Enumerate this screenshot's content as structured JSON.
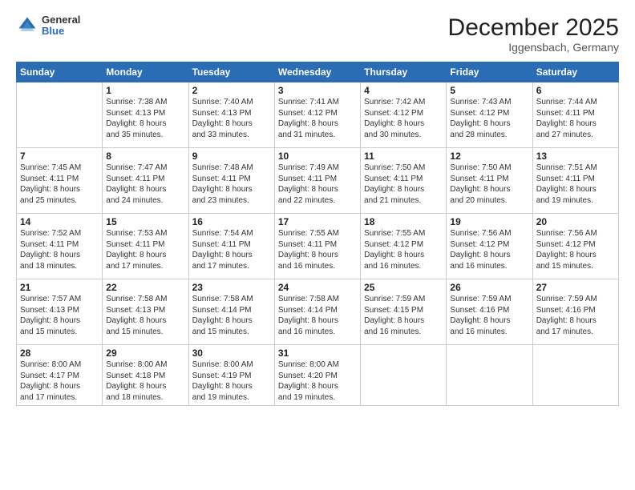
{
  "header": {
    "logo": {
      "general": "General",
      "blue": "Blue"
    },
    "title": "December 2025",
    "subtitle": "Iggensbach, Germany"
  },
  "days_of_week": [
    "Sunday",
    "Monday",
    "Tuesday",
    "Wednesday",
    "Thursday",
    "Friday",
    "Saturday"
  ],
  "weeks": [
    [
      {
        "day": "",
        "sunrise": "",
        "sunset": "",
        "daylight": ""
      },
      {
        "day": "1",
        "sunrise": "Sunrise: 7:38 AM",
        "sunset": "Sunset: 4:13 PM",
        "daylight": "Daylight: 8 hours and 35 minutes."
      },
      {
        "day": "2",
        "sunrise": "Sunrise: 7:40 AM",
        "sunset": "Sunset: 4:13 PM",
        "daylight": "Daylight: 8 hours and 33 minutes."
      },
      {
        "day": "3",
        "sunrise": "Sunrise: 7:41 AM",
        "sunset": "Sunset: 4:12 PM",
        "daylight": "Daylight: 8 hours and 31 minutes."
      },
      {
        "day": "4",
        "sunrise": "Sunrise: 7:42 AM",
        "sunset": "Sunset: 4:12 PM",
        "daylight": "Daylight: 8 hours and 30 minutes."
      },
      {
        "day": "5",
        "sunrise": "Sunrise: 7:43 AM",
        "sunset": "Sunset: 4:12 PM",
        "daylight": "Daylight: 8 hours and 28 minutes."
      },
      {
        "day": "6",
        "sunrise": "Sunrise: 7:44 AM",
        "sunset": "Sunset: 4:11 PM",
        "daylight": "Daylight: 8 hours and 27 minutes."
      }
    ],
    [
      {
        "day": "7",
        "sunrise": "Sunrise: 7:45 AM",
        "sunset": "Sunset: 4:11 PM",
        "daylight": "Daylight: 8 hours and 25 minutes."
      },
      {
        "day": "8",
        "sunrise": "Sunrise: 7:47 AM",
        "sunset": "Sunset: 4:11 PM",
        "daylight": "Daylight: 8 hours and 24 minutes."
      },
      {
        "day": "9",
        "sunrise": "Sunrise: 7:48 AM",
        "sunset": "Sunset: 4:11 PM",
        "daylight": "Daylight: 8 hours and 23 minutes."
      },
      {
        "day": "10",
        "sunrise": "Sunrise: 7:49 AM",
        "sunset": "Sunset: 4:11 PM",
        "daylight": "Daylight: 8 hours and 22 minutes."
      },
      {
        "day": "11",
        "sunrise": "Sunrise: 7:50 AM",
        "sunset": "Sunset: 4:11 PM",
        "daylight": "Daylight: 8 hours and 21 minutes."
      },
      {
        "day": "12",
        "sunrise": "Sunrise: 7:50 AM",
        "sunset": "Sunset: 4:11 PM",
        "daylight": "Daylight: 8 hours and 20 minutes."
      },
      {
        "day": "13",
        "sunrise": "Sunrise: 7:51 AM",
        "sunset": "Sunset: 4:11 PM",
        "daylight": "Daylight: 8 hours and 19 minutes."
      }
    ],
    [
      {
        "day": "14",
        "sunrise": "Sunrise: 7:52 AM",
        "sunset": "Sunset: 4:11 PM",
        "daylight": "Daylight: 8 hours and 18 minutes."
      },
      {
        "day": "15",
        "sunrise": "Sunrise: 7:53 AM",
        "sunset": "Sunset: 4:11 PM",
        "daylight": "Daylight: 8 hours and 17 minutes."
      },
      {
        "day": "16",
        "sunrise": "Sunrise: 7:54 AM",
        "sunset": "Sunset: 4:11 PM",
        "daylight": "Daylight: 8 hours and 17 minutes."
      },
      {
        "day": "17",
        "sunrise": "Sunrise: 7:55 AM",
        "sunset": "Sunset: 4:11 PM",
        "daylight": "Daylight: 8 hours and 16 minutes."
      },
      {
        "day": "18",
        "sunrise": "Sunrise: 7:55 AM",
        "sunset": "Sunset: 4:12 PM",
        "daylight": "Daylight: 8 hours and 16 minutes."
      },
      {
        "day": "19",
        "sunrise": "Sunrise: 7:56 AM",
        "sunset": "Sunset: 4:12 PM",
        "daylight": "Daylight: 8 hours and 16 minutes."
      },
      {
        "day": "20",
        "sunrise": "Sunrise: 7:56 AM",
        "sunset": "Sunset: 4:12 PM",
        "daylight": "Daylight: 8 hours and 15 minutes."
      }
    ],
    [
      {
        "day": "21",
        "sunrise": "Sunrise: 7:57 AM",
        "sunset": "Sunset: 4:13 PM",
        "daylight": "Daylight: 8 hours and 15 minutes."
      },
      {
        "day": "22",
        "sunrise": "Sunrise: 7:58 AM",
        "sunset": "Sunset: 4:13 PM",
        "daylight": "Daylight: 8 hours and 15 minutes."
      },
      {
        "day": "23",
        "sunrise": "Sunrise: 7:58 AM",
        "sunset": "Sunset: 4:14 PM",
        "daylight": "Daylight: 8 hours and 15 minutes."
      },
      {
        "day": "24",
        "sunrise": "Sunrise: 7:58 AM",
        "sunset": "Sunset: 4:14 PM",
        "daylight": "Daylight: 8 hours and 16 minutes."
      },
      {
        "day": "25",
        "sunrise": "Sunrise: 7:59 AM",
        "sunset": "Sunset: 4:15 PM",
        "daylight": "Daylight: 8 hours and 16 minutes."
      },
      {
        "day": "26",
        "sunrise": "Sunrise: 7:59 AM",
        "sunset": "Sunset: 4:16 PM",
        "daylight": "Daylight: 8 hours and 16 minutes."
      },
      {
        "day": "27",
        "sunrise": "Sunrise: 7:59 AM",
        "sunset": "Sunset: 4:16 PM",
        "daylight": "Daylight: 8 hours and 17 minutes."
      }
    ],
    [
      {
        "day": "28",
        "sunrise": "Sunrise: 8:00 AM",
        "sunset": "Sunset: 4:17 PM",
        "daylight": "Daylight: 8 hours and 17 minutes."
      },
      {
        "day": "29",
        "sunrise": "Sunrise: 8:00 AM",
        "sunset": "Sunset: 4:18 PM",
        "daylight": "Daylight: 8 hours and 18 minutes."
      },
      {
        "day": "30",
        "sunrise": "Sunrise: 8:00 AM",
        "sunset": "Sunset: 4:19 PM",
        "daylight": "Daylight: 8 hours and 19 minutes."
      },
      {
        "day": "31",
        "sunrise": "Sunrise: 8:00 AM",
        "sunset": "Sunset: 4:20 PM",
        "daylight": "Daylight: 8 hours and 19 minutes."
      },
      {
        "day": "",
        "sunrise": "",
        "sunset": "",
        "daylight": ""
      },
      {
        "day": "",
        "sunrise": "",
        "sunset": "",
        "daylight": ""
      },
      {
        "day": "",
        "sunrise": "",
        "sunset": "",
        "daylight": ""
      }
    ]
  ]
}
